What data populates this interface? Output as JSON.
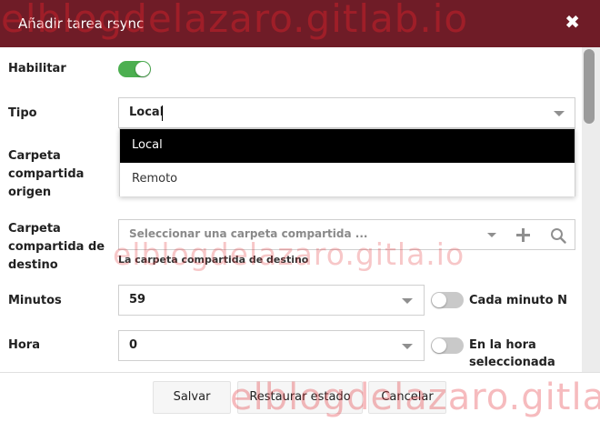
{
  "dialog": {
    "title": "Añadir tarea rsync",
    "close_symbol": "✖"
  },
  "form": {
    "enable": {
      "label": "Habilitar",
      "checked": true
    },
    "type": {
      "label": "Tipo",
      "value": "Local",
      "options": [
        "Local",
        "Remoto"
      ],
      "highlighted": "Local"
    },
    "source": {
      "label_lines": [
        "Carpeta",
        "compartida",
        "origen"
      ]
    },
    "destination": {
      "label_lines": [
        "Carpeta",
        "compartida de",
        "destino"
      ],
      "placeholder": "Seleccionar una carpeta compartida ...",
      "hint": "La carpeta compartida de destino",
      "icons": [
        "chevron-down-icon",
        "plus-icon",
        "search-icon"
      ]
    },
    "minutes": {
      "label": "Minutos",
      "value": "59",
      "toggle_label": "Cada minuto N",
      "toggle_checked": false
    },
    "hour": {
      "label": "Hora",
      "value": "0",
      "toggle_label_lines": [
        "En la hora",
        "seleccionada"
      ],
      "toggle_checked": false
    }
  },
  "buttons": {
    "save": "Salvar",
    "reset": "Restaurar estado",
    "cancel": "Cancelar"
  },
  "watermarks": {
    "top": "elblogdelazaro.gitlab.io",
    "middle": "elblogdelazaro.gitla.io",
    "bottom": "elblogdelazaro.gitla.io"
  },
  "colors": {
    "titlebar": "#6f1c27",
    "toggle_on": "#4caf50",
    "selected_option_bg": "#000000",
    "watermark": "#e2232a"
  }
}
